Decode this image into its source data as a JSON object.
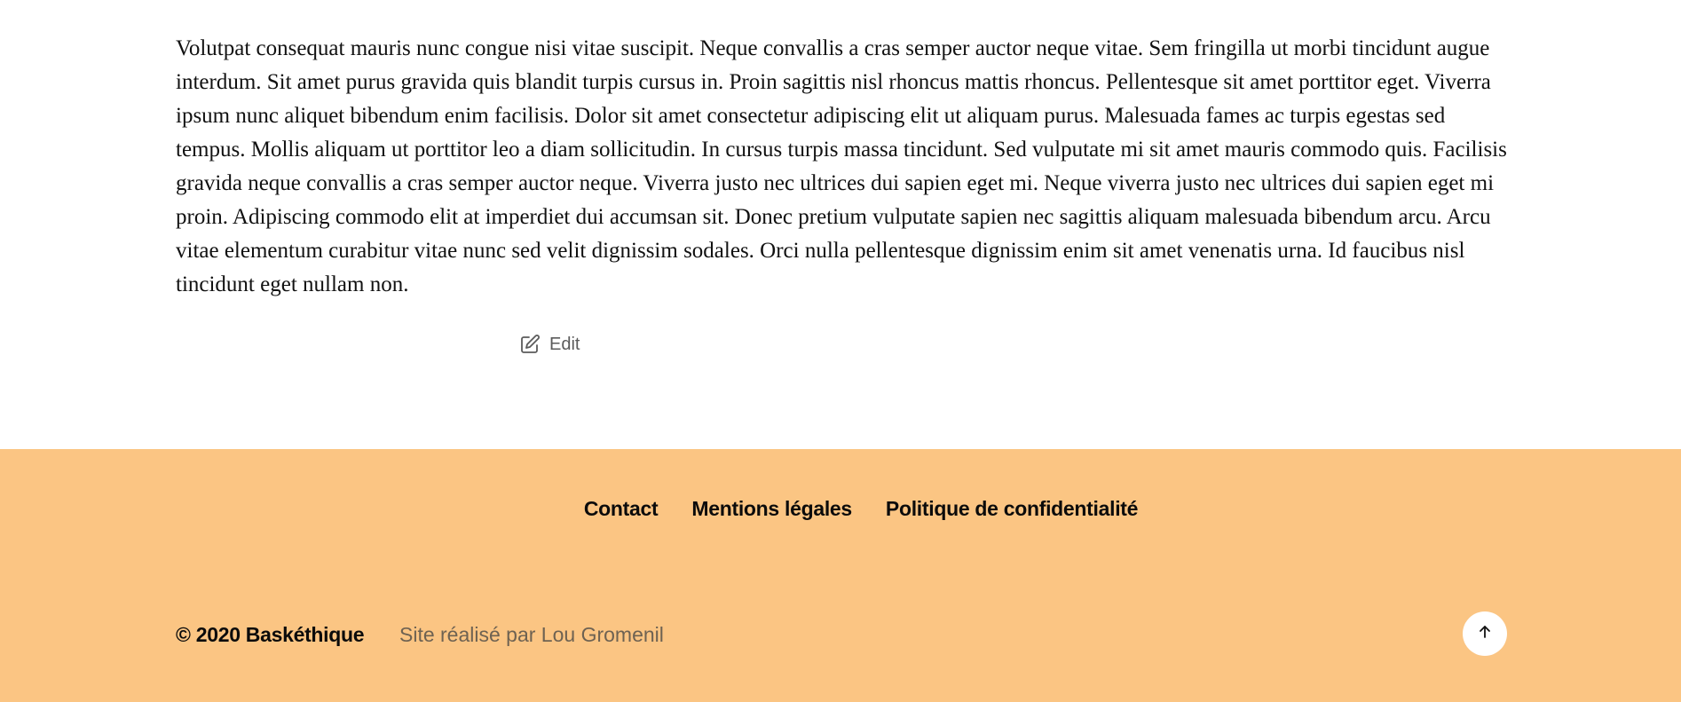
{
  "article": {
    "body": "Volutpat consequat mauris nunc congue nisi vitae suscipit. Neque convallis a cras semper auctor neque vitae. Sem fringilla ut morbi tincidunt augue interdum. Sit amet purus gravida quis blandit turpis cursus in. Proin sagittis nisl rhoncus mattis rhoncus. Pellentesque sit amet porttitor eget. Viverra ipsum nunc aliquet bibendum enim facilisis. Dolor sit amet consectetur adipiscing elit ut aliquam purus. Malesuada fames ac turpis egestas sed tempus. Mollis aliquam ut porttitor leo a diam sollicitudin. In cursus turpis massa tincidunt. Sed vulputate mi sit amet mauris commodo quis. Facilisis gravida neque convallis a cras semper auctor neque. Viverra justo nec ultrices dui sapien eget mi. Neque viverra justo nec ultrices dui sapien eget mi proin. Adipiscing commodo elit at imperdiet dui accumsan sit. Donec pretium vulputate sapien nec sagittis aliquam malesuada bibendum arcu. Arcu vitae elementum curabitur vitae nunc sed velit dignissim sodales. Orci nulla pellentesque dignissim enim sit amet venenatis urna. Id faucibus nisl tincidunt eget nullam non.",
    "edit_label": "Edit",
    "edit_icon": "edit-icon"
  },
  "footer": {
    "background_color": "#fbc583",
    "nav": [
      {
        "label": "Contact"
      },
      {
        "label": "Mentions légales"
      },
      {
        "label": "Politique de confidentialité"
      }
    ],
    "copyright": "© 2020 Baskéthique",
    "credit": "Site réalisé par Lou Gromenil",
    "back_to_top_icon": "arrow-up-icon"
  }
}
